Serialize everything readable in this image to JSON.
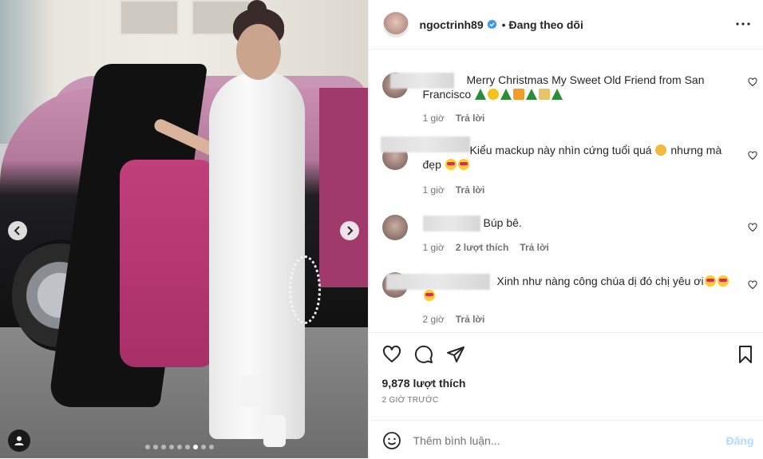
{
  "post_header": {
    "username": "ngoctrinh89",
    "separator": "•",
    "follow_status": "Đang theo dõi"
  },
  "carousel": {
    "total_slides": 9,
    "active_slide": 7
  },
  "comments": [
    {
      "text_1": "Merry Christmas My Sweet Old Friend from San",
      "text_2": "Francisco",
      "time": "1 giờ",
      "reply": "Trả lời",
      "emojis": [
        "tree",
        "star",
        "tree",
        "gift",
        "tree",
        "glass",
        "tree"
      ]
    },
    {
      "text_1": "Kiểu mackup này nhìn cứng tuổi quá",
      "text_1b": "nhưng mà",
      "text_2": "đẹp",
      "time": "1 giờ",
      "reply": "Trả lời"
    },
    {
      "text_1": "Búp bê.",
      "time": "1 giờ",
      "likes": "2 lượt thích",
      "reply": "Trả lời"
    },
    {
      "text_1": "Xinh như nàng công chúa dị đó chị yêu ơi",
      "time": "2 giờ",
      "reply": "Trả lời"
    }
  ],
  "stats": {
    "likes": "9,878 lượt thích",
    "posted": "2 GIỜ TRƯỚC"
  },
  "add_comment": {
    "placeholder": "Thêm bình luận...",
    "post_label": "Đăng"
  },
  "colors": {
    "verified": "#3897f0",
    "post_disabled": "#b3dbff",
    "meta": "#737373"
  }
}
